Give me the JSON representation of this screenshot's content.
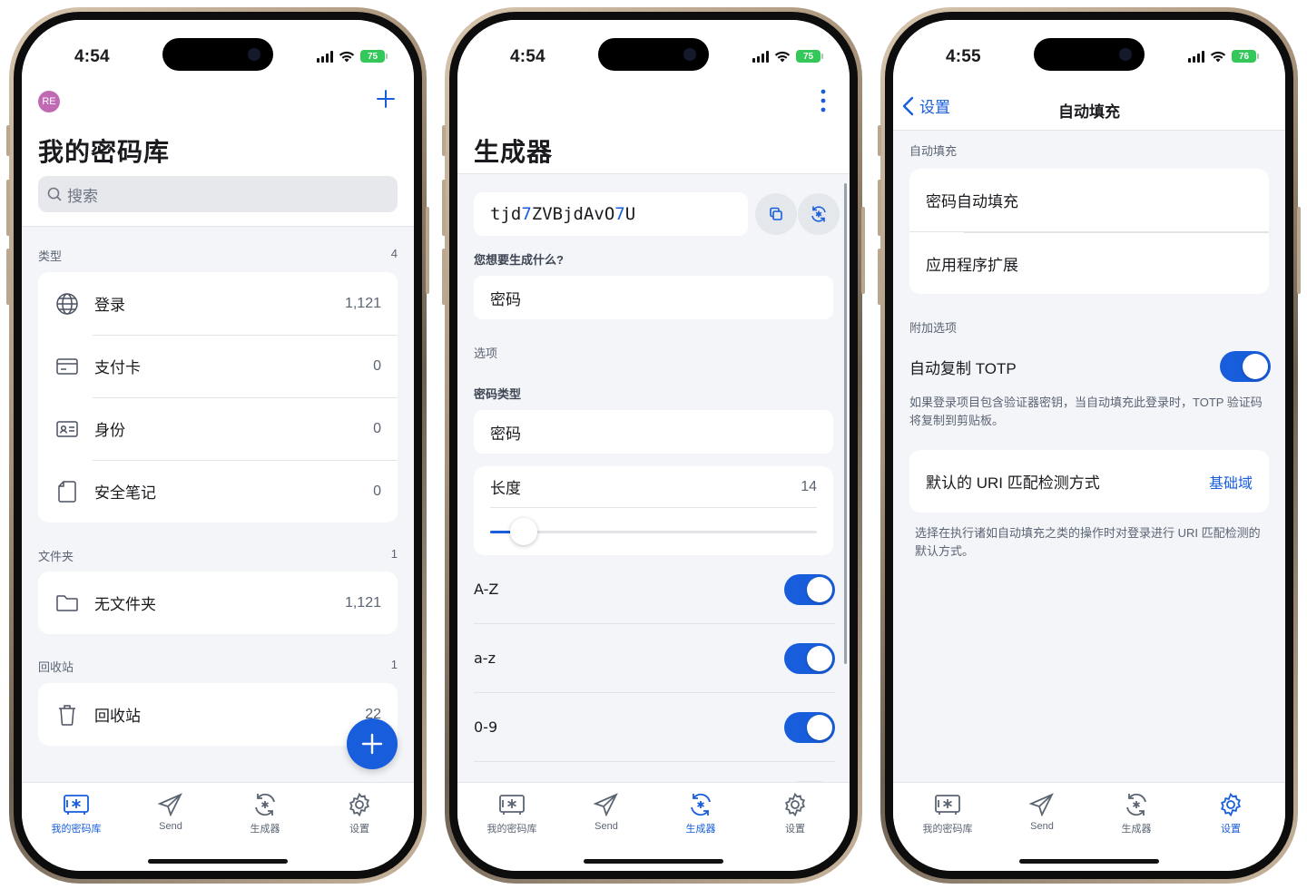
{
  "status": {
    "phone1_time": "4:54",
    "phone2_time": "4:54",
    "phone3_time": "4:55",
    "phone1_battery": "75",
    "phone2_battery": "75",
    "phone3_battery": "76"
  },
  "vault": {
    "avatar": "RE",
    "title": "我的密码库",
    "search_placeholder": "搜索",
    "types_label": "类型",
    "types_count": "4",
    "types": [
      {
        "label": "登录",
        "count": "1,121",
        "icon": "globe-icon"
      },
      {
        "label": "支付卡",
        "count": "0",
        "icon": "credit-card-icon"
      },
      {
        "label": "身份",
        "count": "0",
        "icon": "id-card-icon"
      },
      {
        "label": "安全笔记",
        "count": "0",
        "icon": "note-icon"
      }
    ],
    "folders_label": "文件夹",
    "folders_count": "1",
    "folders": [
      {
        "label": "无文件夹",
        "count": "1,121",
        "icon": "folder-icon"
      }
    ],
    "trash_label": "回收站",
    "trash_count": "1",
    "trash": [
      {
        "label": "回收站",
        "count": "22",
        "icon": "trash-icon"
      }
    ]
  },
  "generator": {
    "title": "生成器",
    "password_part1": "tjd",
    "password_num1": "7",
    "password_part2": "ZVBjdAvO",
    "password_num2": "7",
    "password_part3": "U",
    "what_label": "您想要生成什么?",
    "what_value": "密码",
    "options_label": "选项",
    "type_label": "密码类型",
    "type_value": "密码",
    "length_label": "长度",
    "length_value": "14",
    "length_fraction": 0.1,
    "toggles": [
      {
        "label": "A-Z",
        "on": true
      },
      {
        "label": "a-z",
        "on": true
      },
      {
        "label": "0-9",
        "on": true
      },
      {
        "label": "!@#$%^&*",
        "on": false
      }
    ]
  },
  "autofill": {
    "back_label": "设置",
    "nav_title": "自动填充",
    "section1_label": "自动填充",
    "items": [
      "密码自动填充",
      "应用程序扩展"
    ],
    "section2_label": "附加选项",
    "totp_label": "自动复制 TOTP",
    "totp_on": true,
    "totp_note": "如果登录项目包含验证器密钥，当自动填充此登录时，TOTP 验证码将复制到剪贴板。",
    "uri_label": "默认的 URI 匹配检测方式",
    "uri_value": "基础域",
    "uri_note": "选择在执行诸如自动填充之类的操作时对登录进行 URI 匹配检测的默认方式。"
  },
  "tabs": [
    {
      "label": "我的密码库",
      "icon": "vault-icon"
    },
    {
      "label": "Send",
      "icon": "send-icon"
    },
    {
      "label": "生成器",
      "icon": "generator-icon"
    },
    {
      "label": "设置",
      "icon": "gear-icon"
    }
  ],
  "colors": {
    "accent": "#175ddc",
    "background": "#f3f5f8",
    "battery": "#34c759",
    "avatar": "#c06ab4"
  }
}
